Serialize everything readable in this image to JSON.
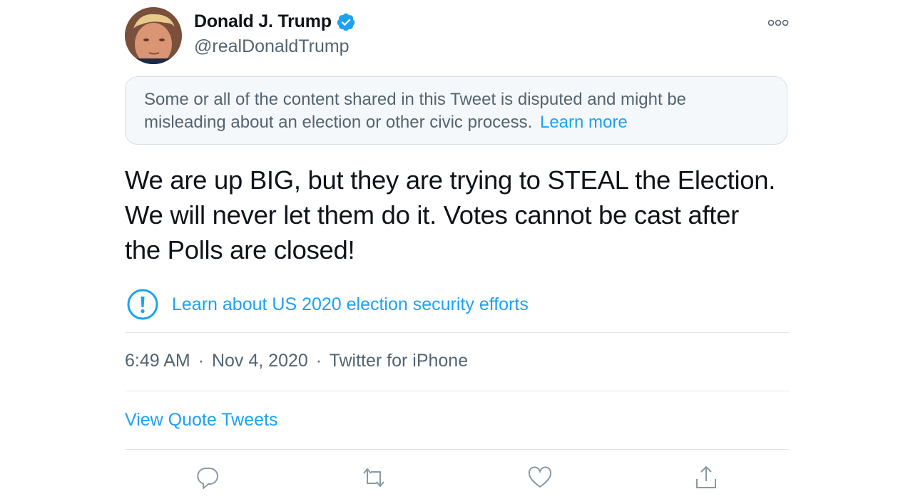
{
  "author": {
    "display_name": "Donald J. Trump",
    "handle": "@realDonaldTrump",
    "verified": true
  },
  "notice": {
    "text": "Some or all of the content shared in this Tweet is disputed and might be misleading about an election or other civic process.",
    "link_label": "Learn more"
  },
  "tweet": {
    "lines": [
      "We are up BIG, but they are trying to STEAL the Election.",
      "We will never let them do it. Votes cannot be cast after",
      "the Polls are closed!"
    ]
  },
  "election_label": {
    "text": "Learn about US 2020 election security efforts",
    "icon": "exclamation-circle-icon"
  },
  "meta": {
    "time": "6:49 AM",
    "date": "Nov 4, 2020",
    "separator": "·",
    "source": "Twitter for iPhone"
  },
  "quote_tweets_label": "View Quote Tweets",
  "actions": [
    {
      "name": "reply",
      "icon": "reply-icon"
    },
    {
      "name": "retweet",
      "icon": "retweet-icon"
    },
    {
      "name": "like",
      "icon": "heart-icon"
    },
    {
      "name": "share",
      "icon": "share-icon"
    }
  ],
  "colors": {
    "link": "#1da1f2",
    "text": "#0f1419",
    "secondary": "#536471",
    "notice_bg": "#f5f8fa",
    "verified": "#1da1f2"
  }
}
